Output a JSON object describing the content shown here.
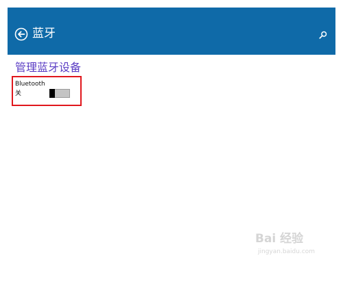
{
  "header": {
    "title": "蓝牙",
    "back_icon": "back-arrow-circle-icon",
    "search_icon": "search-icon",
    "background": "#0f6aa8"
  },
  "section": {
    "title": "管理蓝牙设备",
    "title_color": "#5a3cc4"
  },
  "bluetooth": {
    "label": "Bluetooth",
    "state": "关",
    "enabled": false
  },
  "highlight": {
    "color": "#e0161c"
  },
  "watermark": {
    "text": "Bai 经验",
    "url": "jingyan.baidu.com"
  }
}
